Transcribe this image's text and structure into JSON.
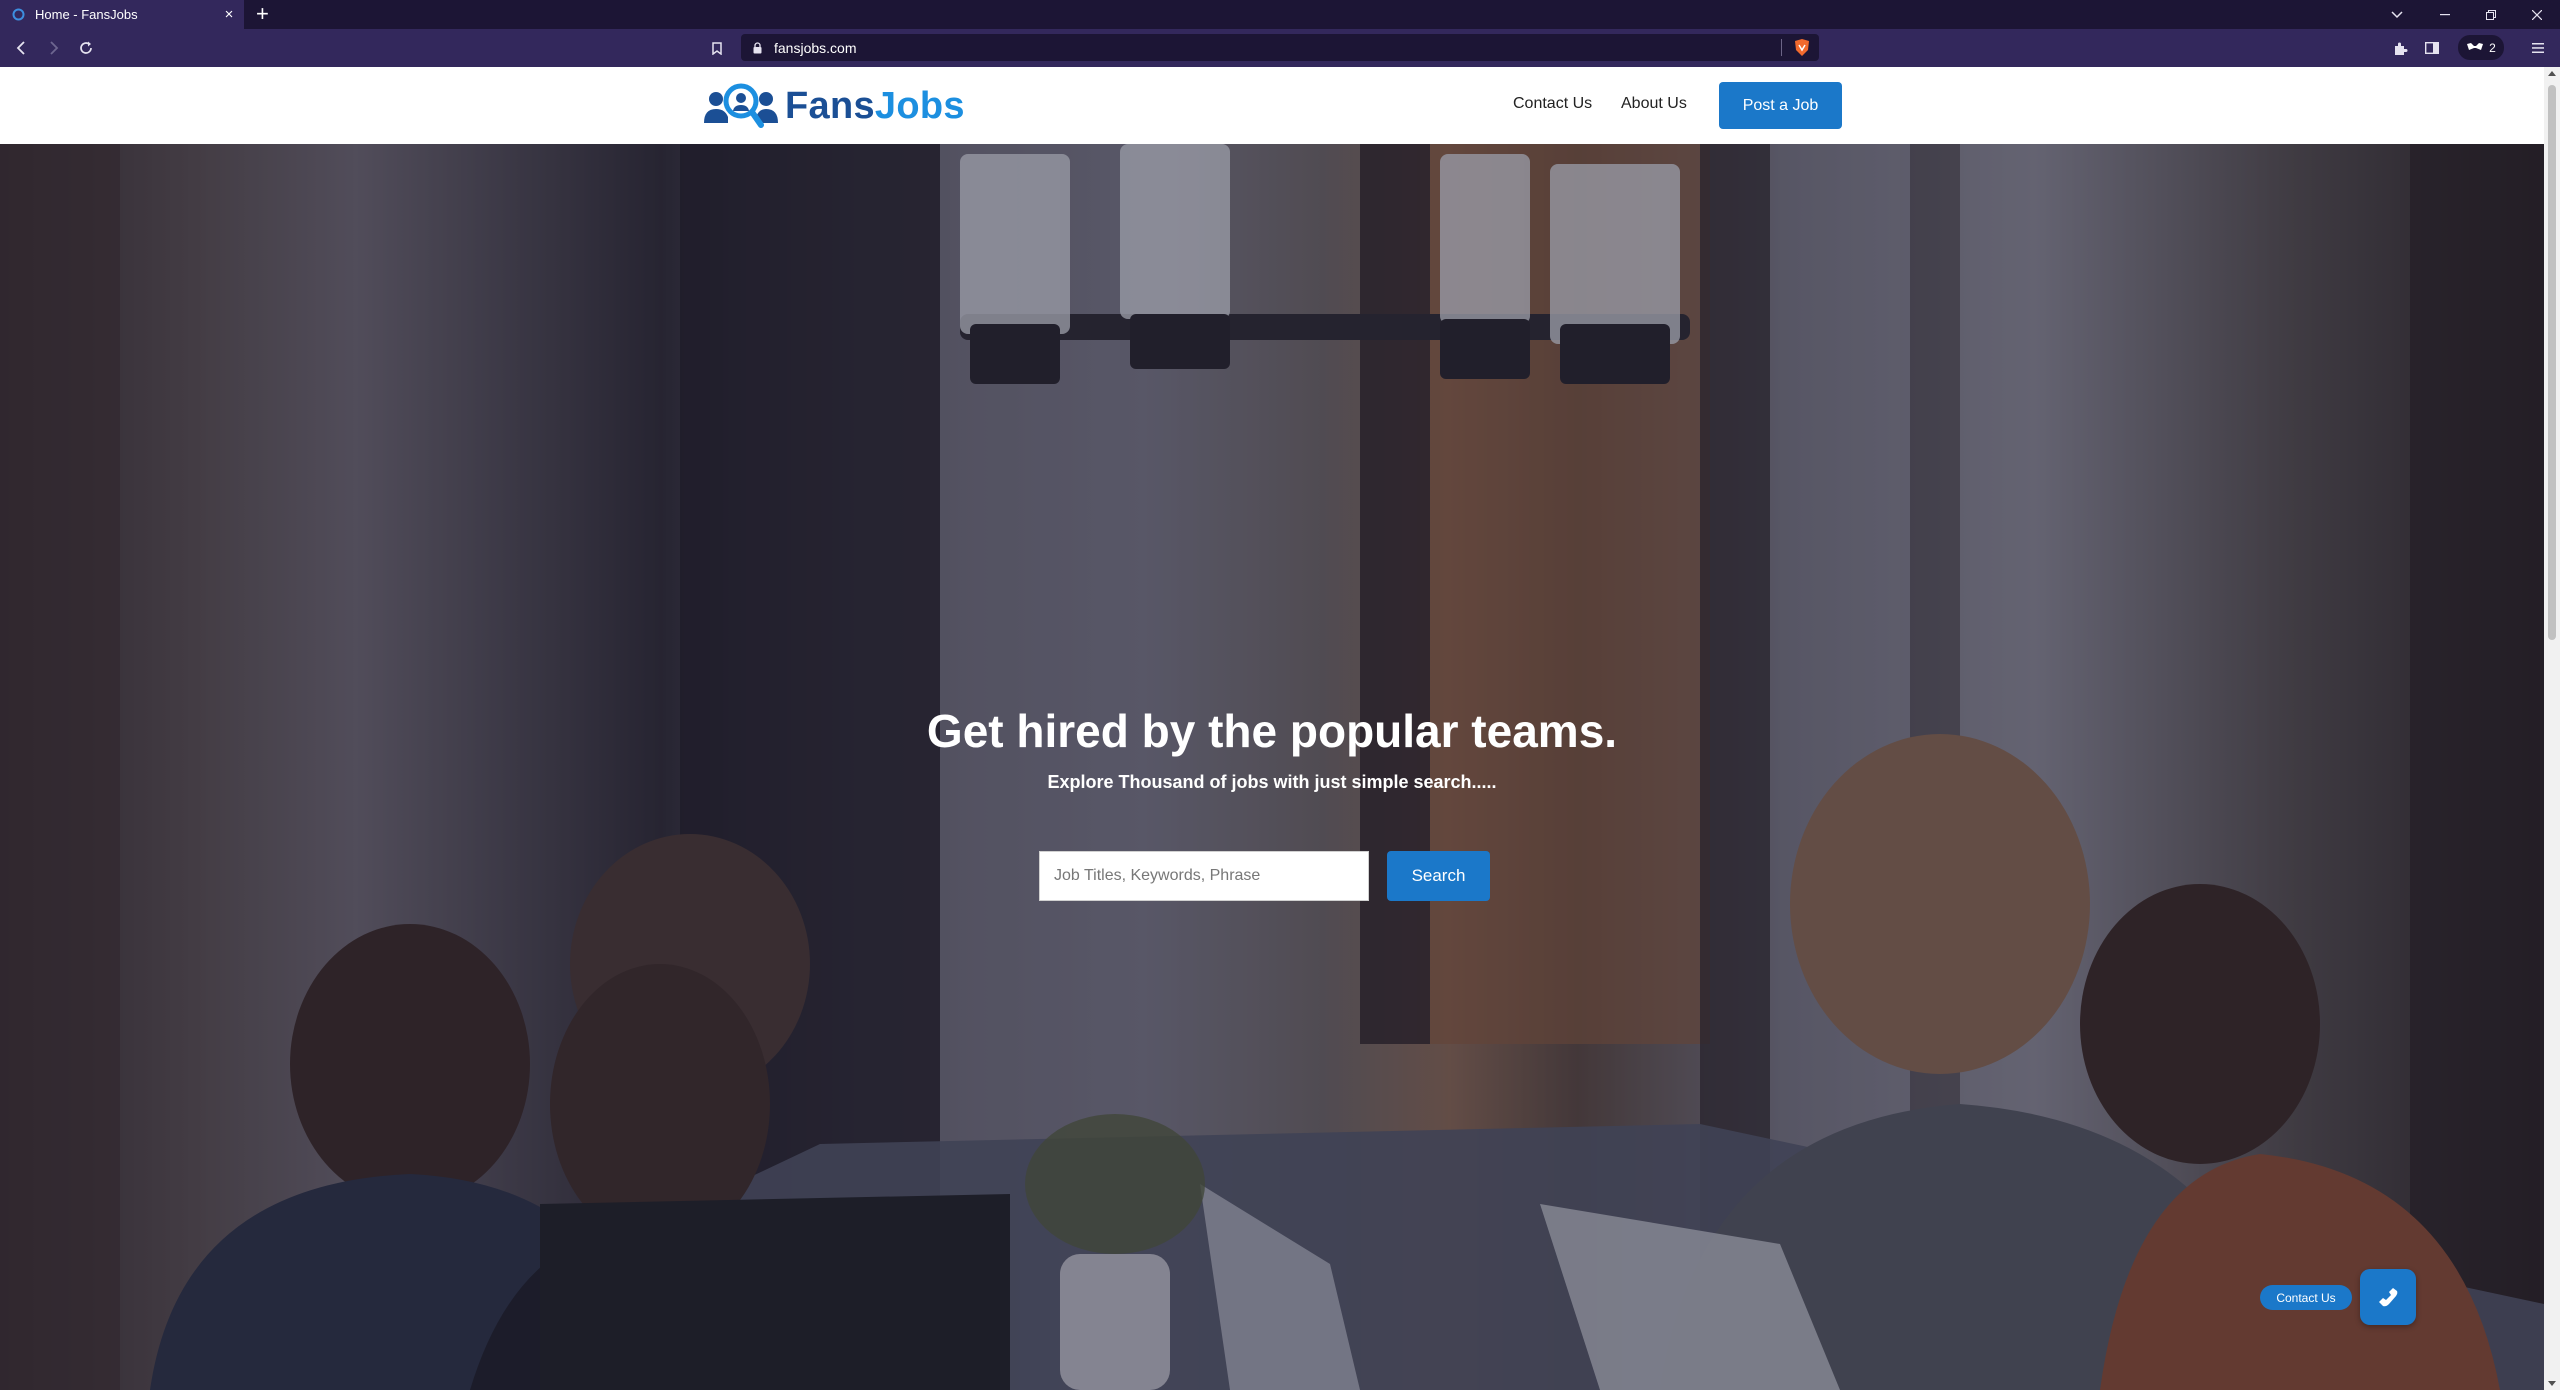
{
  "browser": {
    "tab_title": "Home - FansJobs",
    "tab_close": "×",
    "new_tab": "+",
    "url": "fansjobs.com",
    "wallet_count": "2"
  },
  "header": {
    "logo_brand_main": "Fans",
    "logo_brand_accent": "Jobs",
    "nav": [
      {
        "label": "Contact Us"
      },
      {
        "label": "About Us"
      }
    ],
    "post_job_label": "Post a Job"
  },
  "hero": {
    "title": "Get hired by the popular teams.",
    "subtitle": "Explore Thousand of jobs with just simple search.....",
    "search_placeholder": "Job Titles, Keywords, Phrase",
    "search_label": "Search"
  },
  "floating": {
    "contact_label": "Contact Us"
  },
  "colors": {
    "primary_blue": "#1b78c9",
    "logo_dark": "#1b4f95",
    "browser_chrome": "#33285c"
  }
}
